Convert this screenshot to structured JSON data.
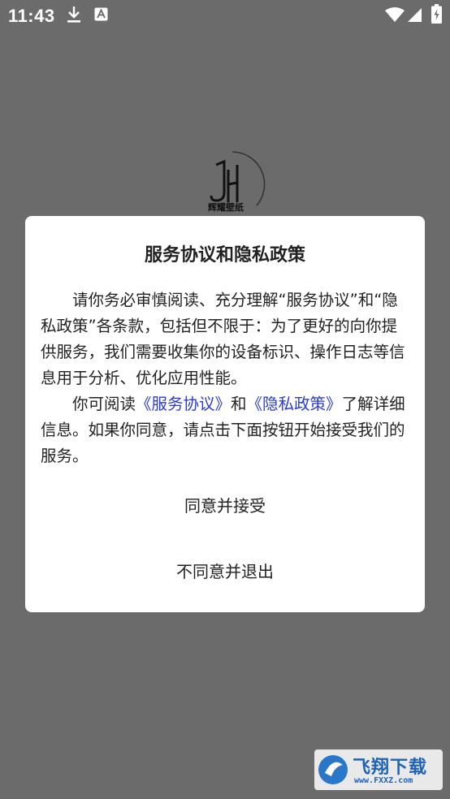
{
  "status_bar": {
    "time": "11:43",
    "icons": [
      "download-icon",
      "notification-a-icon",
      "wifi-icon",
      "cellular-signal-icon",
      "battery-charging-icon"
    ]
  },
  "background": {
    "app_logo": {
      "icon": "app-logo-icon",
      "text": "辉耀壁纸"
    }
  },
  "dialog": {
    "title": "服务协议和隐私政策",
    "paragraph1": "请你务必审慎阅读、充分理解“服务协议”和“隐私政策”各条款，包括但不限于：为了更好的向你提供服务，我们需要收集你的设备标识、操作日志等信息用于分析、优化应用性能。",
    "paragraph2": {
      "prefix": "你可阅读",
      "link_service": "《服务协议》",
      "middle": "和",
      "link_privacy": "《隐私政策》",
      "suffix": "了解详细信息。如果你同意，请点击下面按钮开始接受我们的服务。"
    },
    "accept_label": "同意并接受",
    "reject_label": "不同意并退出"
  },
  "watermark": {
    "text": "飞翔下载",
    "url_text": "www.FXXZ.com"
  },
  "colors": {
    "backdrop": "#6b6b6b",
    "dialog_bg": "#ffffff",
    "link": "#2a3bd4",
    "text": "#222222"
  }
}
